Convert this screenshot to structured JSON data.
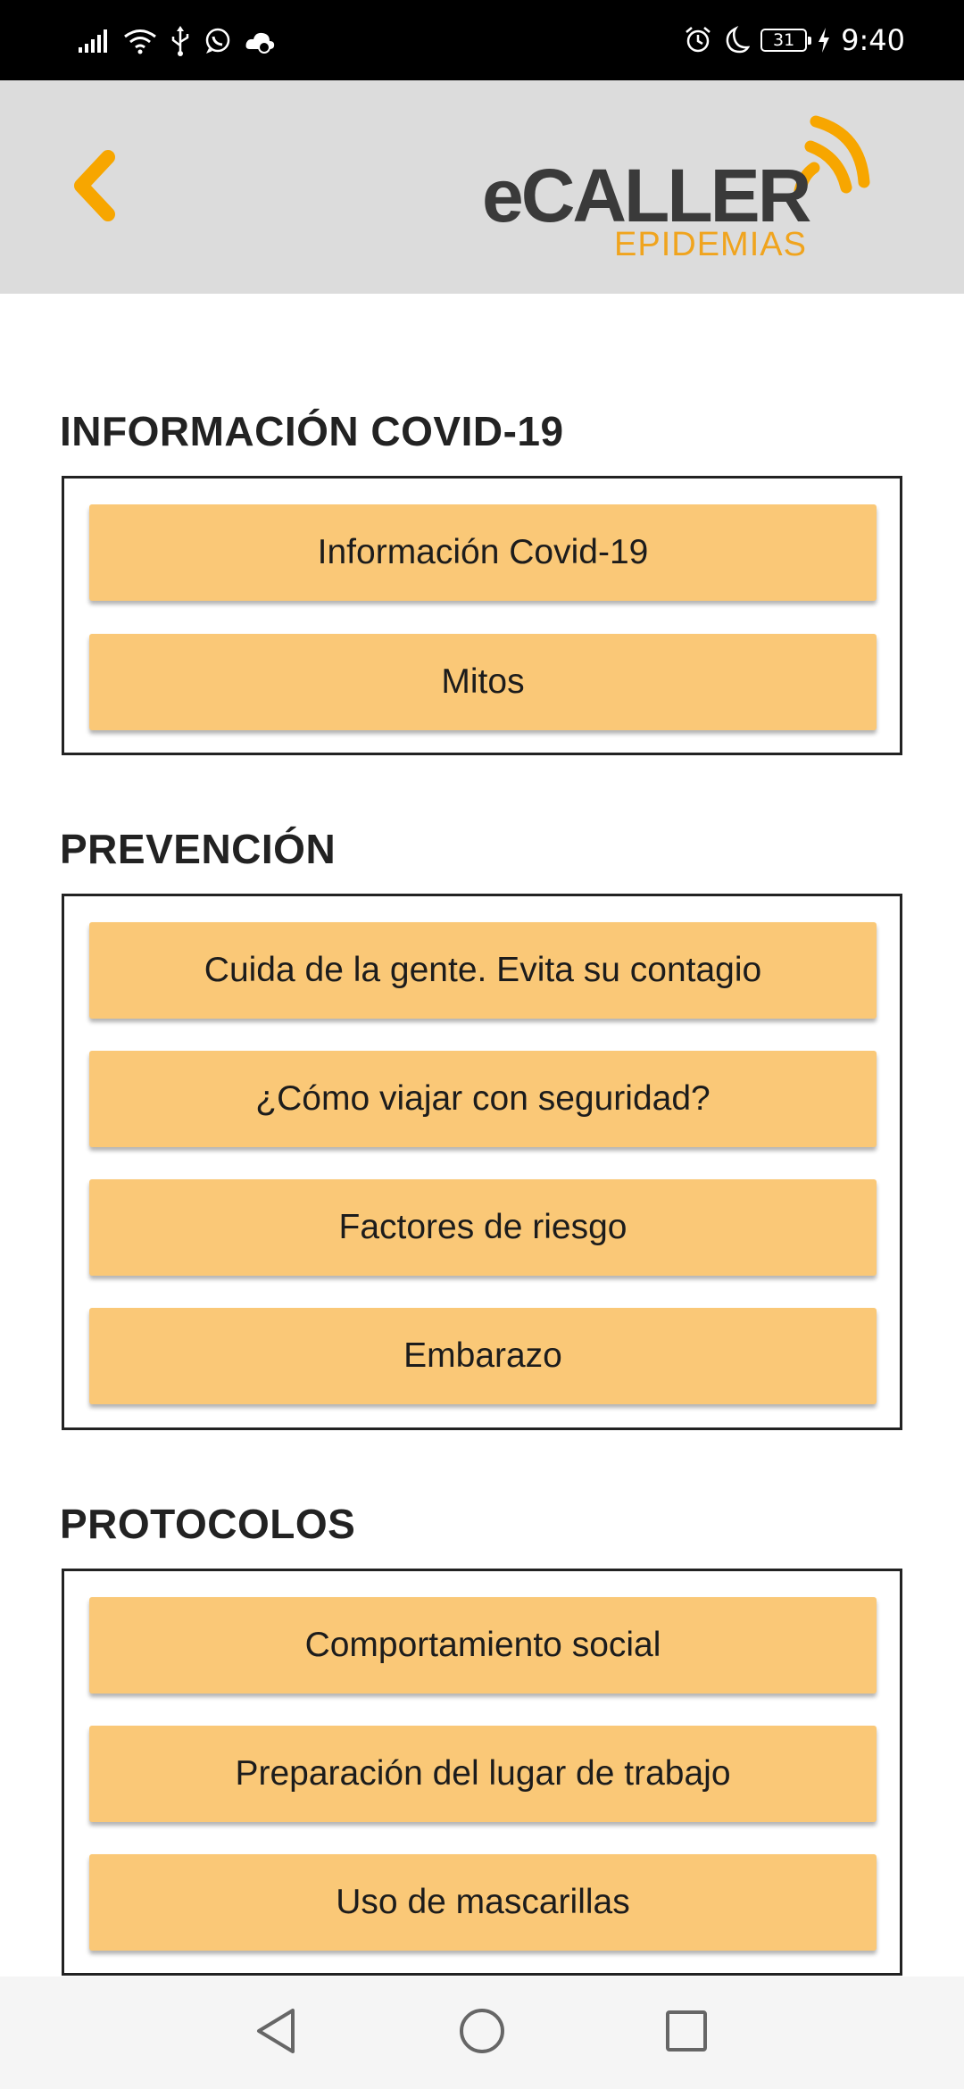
{
  "status_bar": {
    "time": "9:40",
    "battery_level": "31",
    "icons_left": [
      "signal-icon",
      "wifi-icon",
      "usb-icon",
      "whatsapp-icon",
      "weather-icon"
    ],
    "icons_right": [
      "alarm-icon",
      "moon-icon",
      "battery-icon",
      "charging-icon"
    ]
  },
  "header": {
    "logo_main": "eCALLER",
    "logo_sub": "EPIDEMIAS",
    "back_icon": "chevron-left-icon",
    "colors": {
      "background": "#dcdcdc",
      "accent": "#f7a600"
    }
  },
  "sections": [
    {
      "title": "INFORMACIÓN COVID-19",
      "buttons": [
        "Información Covid-19",
        "Mitos"
      ]
    },
    {
      "title": "PREVENCIÓN",
      "buttons": [
        "Cuida de la gente. Evita su contagio",
        "¿Cómo viajar con seguridad?",
        "Factores de riesgo",
        "Embarazo"
      ]
    },
    {
      "title": "PROTOCOLOS",
      "buttons": [
        "Comportamiento social",
        "Preparación del lugar de trabajo",
        "Uso de mascarillas"
      ]
    }
  ],
  "nav_bar": {
    "icons": [
      "back-triangle-icon",
      "home-circle-icon",
      "recents-square-icon"
    ]
  },
  "colors": {
    "button_fill": "#fac877",
    "border": "#222222"
  }
}
